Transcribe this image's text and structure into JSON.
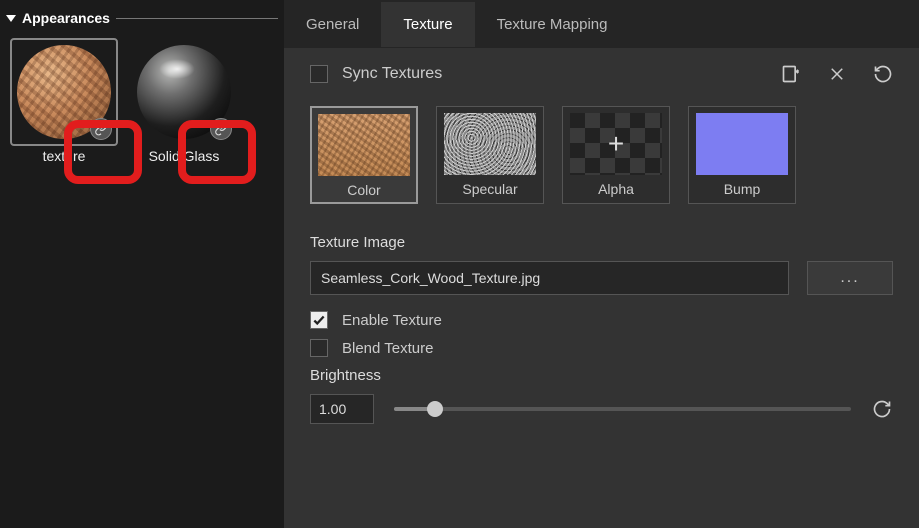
{
  "sidebar": {
    "title": "Appearances",
    "items": [
      {
        "label": "texture",
        "badge": "link-warning-icon"
      },
      {
        "label": "Solid Glass",
        "badge": "link-warning-icon"
      }
    ]
  },
  "tabs": [
    {
      "label": "General"
    },
    {
      "label": "Texture"
    },
    {
      "label": "Texture Mapping"
    }
  ],
  "active_tab_index": 1,
  "sync": {
    "label": "Sync Textures",
    "checked": false
  },
  "action_icons": {
    "export": "export-icon",
    "delete": "close-icon",
    "refresh": "refresh-icon"
  },
  "channels": [
    {
      "label": "Color",
      "kind": "cork",
      "selected": true
    },
    {
      "label": "Specular",
      "kind": "specular",
      "selected": false
    },
    {
      "label": "Alpha",
      "kind": "alpha",
      "selected": false
    },
    {
      "label": "Bump",
      "kind": "bump",
      "selected": false
    }
  ],
  "texture_image": {
    "section_label": "Texture Image",
    "filename": "Seamless_Cork_Wood_Texture.jpg",
    "browse_label": "..."
  },
  "options": {
    "enable": {
      "label": "Enable Texture",
      "checked": true
    },
    "blend": {
      "label": "Blend Texture",
      "checked": false
    }
  },
  "brightness": {
    "label": "Brightness",
    "value": "1.00",
    "slider_percent": 9
  }
}
